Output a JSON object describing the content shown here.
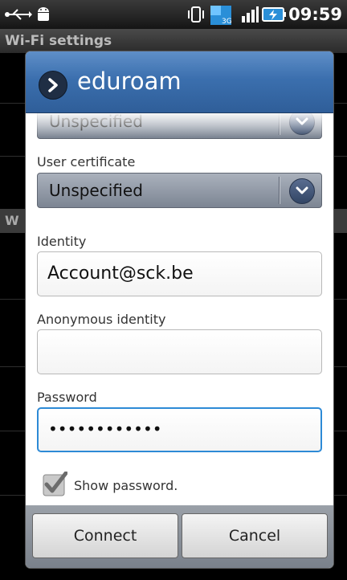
{
  "status_bar": {
    "time": "09:59",
    "icons": [
      "usb-icon",
      "android-icon",
      "vibrate-icon",
      "data-transfer-icon",
      "signal-icon",
      "battery-charging-icon"
    ]
  },
  "background": {
    "title": "Wi-Fi settings",
    "section_header": "W"
  },
  "dialog": {
    "title": "eduroam",
    "ca_certificate": {
      "value": "Unspecified"
    },
    "user_certificate": {
      "label": "User certificate",
      "value": "Unspecified"
    },
    "identity": {
      "label": "Identity",
      "value": "Account@sck.be"
    },
    "anonymous_identity": {
      "label": "Anonymous identity",
      "value": ""
    },
    "password": {
      "label": "Password",
      "value": "••••••••••••"
    },
    "show_password": {
      "label": "Show password.",
      "checked": true
    },
    "buttons": {
      "connect": "Connect",
      "cancel": "Cancel"
    }
  }
}
